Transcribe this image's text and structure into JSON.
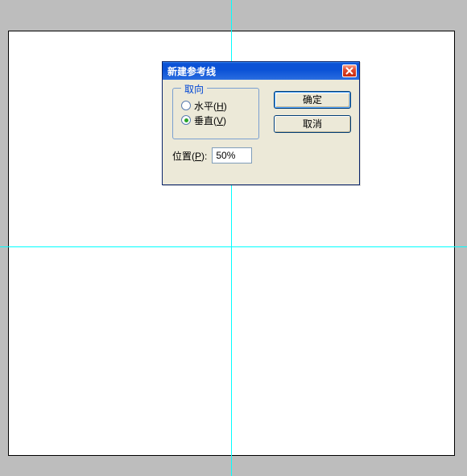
{
  "dialog": {
    "title": "新建参考线",
    "fieldset": {
      "legend": "取向",
      "horizontal_label": "水平",
      "horizontal_accel": "H",
      "vertical_label": "垂直",
      "vertical_accel": "V",
      "selected": "vertical"
    },
    "buttons": {
      "ok": "确定",
      "cancel": "取消"
    },
    "position": {
      "label": "位置",
      "accel": "P",
      "value": "50%"
    }
  }
}
